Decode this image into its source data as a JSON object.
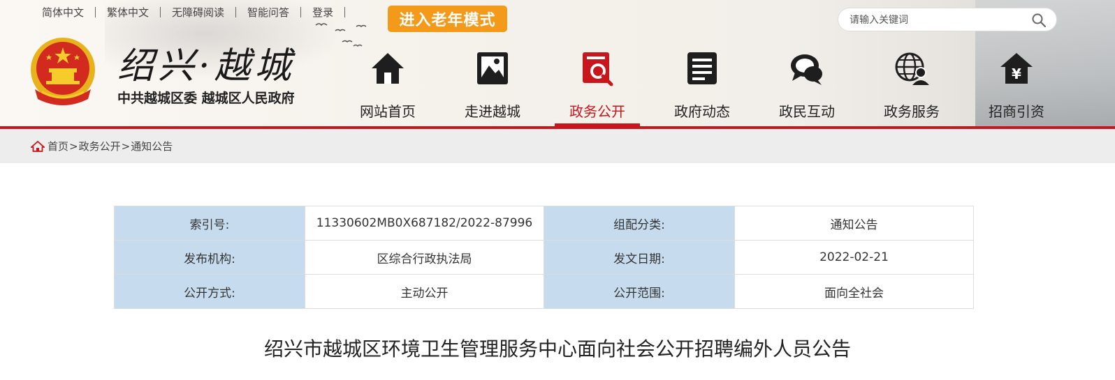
{
  "topbar": {
    "links": [
      "简体中文",
      "繁体中文",
      "无障碍阅读",
      "智能问答",
      "登录"
    ],
    "elder_mode": "进入老年模式"
  },
  "search": {
    "placeholder": "请输入关键词",
    "icon": "search-icon"
  },
  "brand": {
    "title": "绍兴·越城",
    "subtitle": "中共越城区委 越城区人民政府"
  },
  "nav": {
    "items": [
      {
        "label": "网站首页",
        "icon": "home-icon"
      },
      {
        "label": "走进越城",
        "icon": "picture-icon"
      },
      {
        "label": "政务公开",
        "icon": "document-search-icon",
        "active": true
      },
      {
        "label": "政府动态",
        "icon": "news-icon"
      },
      {
        "label": "政民互动",
        "icon": "chat-icon"
      },
      {
        "label": "政务服务",
        "icon": "globe-user-icon"
      },
      {
        "label": "招商引资",
        "icon": "yuan-house-icon"
      }
    ]
  },
  "breadcrumb": [
    "首页",
    "政务公开",
    "通知公告"
  ],
  "meta": {
    "rows": [
      [
        "索引号:",
        "11330602MB0X687182/2022-87996",
        "组配分类:",
        "通知公告"
      ],
      [
        "发布机构:",
        "区综合行政执法局",
        "发文日期:",
        "2022-02-21"
      ],
      [
        "公开方式:",
        "主动公开",
        "公开范围:",
        "面向全社会"
      ]
    ]
  },
  "article": {
    "title": "绍兴市越城区环境卫生管理服务中心面向社会公开招聘编外人员公告"
  },
  "colors": {
    "accent_red": "#c8161d",
    "elder_orange": "#f39a1b",
    "label_blue": "#c6dcee",
    "breadcrumb_bg": "#ededed"
  }
}
